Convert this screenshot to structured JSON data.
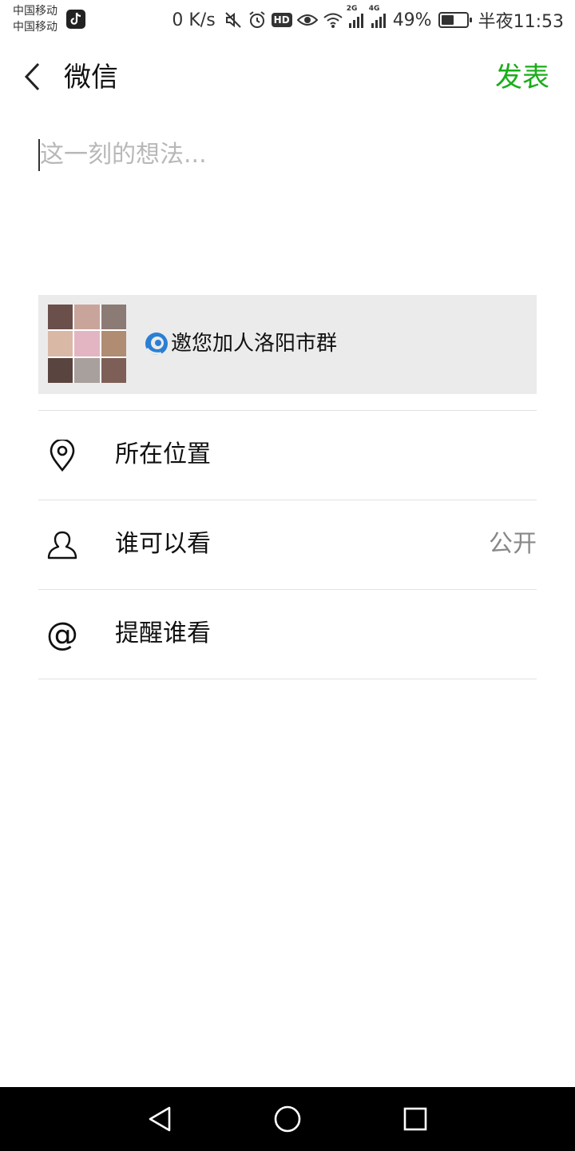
{
  "status_bar": {
    "carrier_1": "中国移动",
    "carrier_2": "中国移动",
    "net_speed": "0 K/s",
    "hd_label": "HD",
    "signal_1_label": "2G",
    "signal_2_label": "4G",
    "battery_text": "49%",
    "battery_level": 0.49,
    "time": "半夜11:53",
    "icons": [
      "tiktok-icon",
      "mute-icon",
      "alarm-icon",
      "hd-icon",
      "eye-icon",
      "wifi-icon",
      "signal-icon",
      "battery-icon"
    ]
  },
  "header": {
    "back_icon": "chevron-left-icon",
    "title": "微信",
    "publish_label": "发表",
    "publish_color": "#1aad19"
  },
  "composer": {
    "placeholder": "这一刻的想法...",
    "value": ""
  },
  "link_card": {
    "title": "邀您加人洛阳市群",
    "icon": "link-logo-icon",
    "background": "#ebebeb"
  },
  "options": [
    {
      "icon": "location-pin-icon",
      "label": "所在位置",
      "value": ""
    },
    {
      "icon": "person-icon",
      "label": "谁可以看",
      "value": "公开"
    },
    {
      "icon": "at-icon",
      "label": "提醒谁看",
      "value": ""
    }
  ],
  "at_symbol": "@",
  "nav_bar": {
    "icons": [
      "nav-back-icon",
      "nav-home-icon",
      "nav-recents-icon"
    ]
  }
}
